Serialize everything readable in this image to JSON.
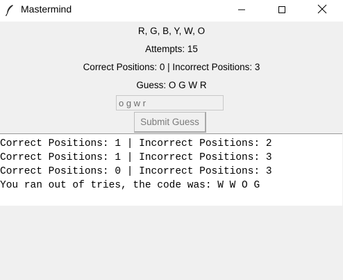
{
  "window": {
    "title": "Mastermind"
  },
  "icons": {
    "app": "feather-icon",
    "minimize": "minimize-icon",
    "maximize": "maximize-icon",
    "close": "close-icon"
  },
  "game": {
    "colors_label": "R, G, B, Y, W, O",
    "attempts_label": "Attempts: 15",
    "feedback_label": "Correct Positions: 0 | Incorrect Positions: 3",
    "guess_label": "Guess: O G W R"
  },
  "guess_input": {
    "value": "o g w r"
  },
  "submit_button": {
    "label": "Submit Guess"
  },
  "log": {
    "lines": [
      "Correct Positions: 1 | Incorrect Positions: 2",
      "Correct Positions: 1 | Incorrect Positions: 3",
      "Correct Positions: 0 | Incorrect Positions: 3",
      "You ran out of tries, the code was: W W O G"
    ]
  }
}
